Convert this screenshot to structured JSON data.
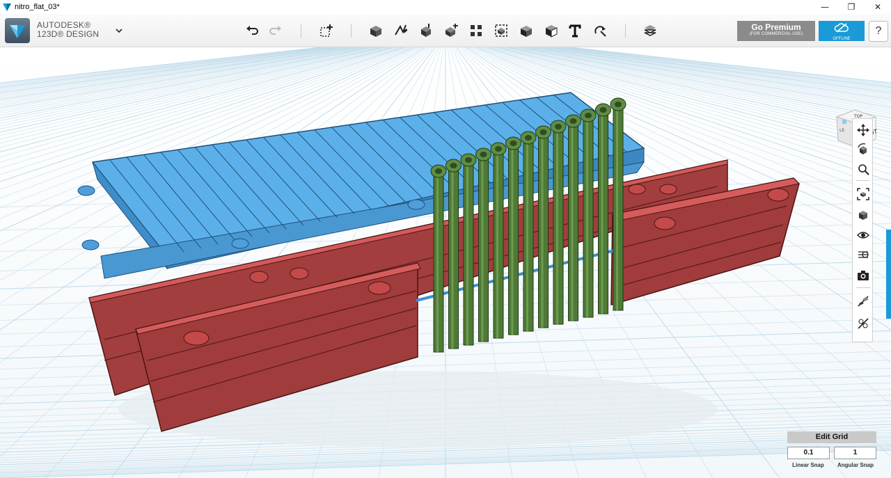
{
  "window": {
    "title": "nitro_flat_03*",
    "controls": [
      "—",
      "❐",
      "✕"
    ]
  },
  "brand": {
    "line1": "AUTODESK®",
    "line2": "123D® DESIGN"
  },
  "toolbar": {
    "undo_icon": "undo-icon",
    "redo_icon": "redo-icon",
    "tools": [
      "primitives",
      "sketch",
      "construct",
      "modify",
      "pattern",
      "grouping",
      "combine",
      "measure",
      "text",
      "snap",
      "material"
    ],
    "premium": {
      "title": "Go Premium",
      "subtitle": "(FOR COMMERCIAL USE)"
    },
    "offline": "OFFLINE",
    "help": "?"
  },
  "viewcube": {
    "top": "TOP",
    "front": "FRONT",
    "left": "LE"
  },
  "navbar": [
    "pan",
    "orbit",
    "zoom",
    "fit",
    "views",
    "visibility",
    "materials",
    "screenshot",
    "snap-edit",
    "material-edit"
  ],
  "grid": {
    "title": "Edit Grid",
    "linear_value": "0.1",
    "angular_value": "1",
    "linear_label": "Linear Snap",
    "angular_label": "Angular Snap"
  },
  "colors": {
    "accent": "#1a9ad6",
    "blue_part": "#5aaee8",
    "red_part": "#a23f3f",
    "green_part": "#4f7a36",
    "grid_line": "#b9d7e8"
  }
}
